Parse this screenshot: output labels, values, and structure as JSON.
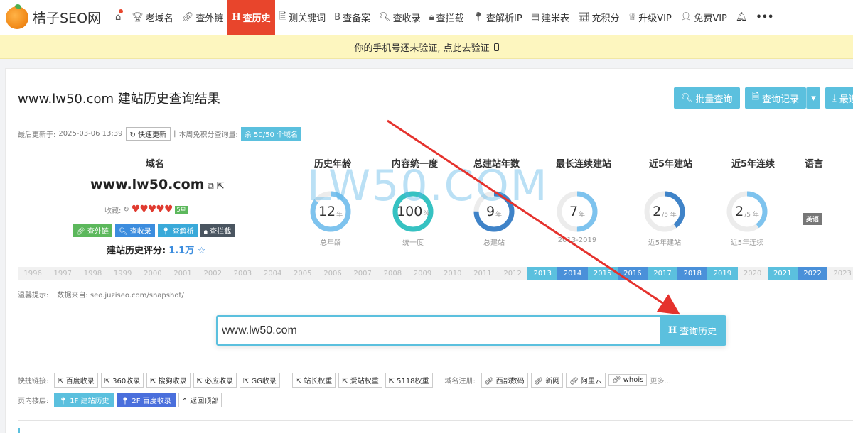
{
  "nav": {
    "logo_text": "桔子SEO网",
    "items": [
      {
        "label": "老域名",
        "icon": "trophy-icon",
        "glyph": "🏆︎"
      },
      {
        "label": "查外链",
        "icon": "link-icon",
        "glyph": "🔗︎"
      },
      {
        "label": "查历史",
        "icon": "h-icon",
        "glyph": "H"
      },
      {
        "label": "测关键词",
        "icon": "document-icon",
        "glyph": "🗎"
      },
      {
        "label": "查备案",
        "icon": "bold-b-icon",
        "glyph": "B"
      },
      {
        "label": "查收录",
        "icon": "search-icon",
        "glyph": "🔍︎"
      },
      {
        "label": "查拦截",
        "icon": "lock-icon",
        "glyph": "🔒︎"
      },
      {
        "label": "查解析IP",
        "icon": "map-pin-icon",
        "glyph": "📍︎"
      },
      {
        "label": "建米表",
        "icon": "table-icon",
        "glyph": "▤"
      },
      {
        "label": "充积分",
        "icon": "bar-chart-icon",
        "glyph": "📊︎"
      },
      {
        "label": "升级VIP",
        "icon": "crown-icon",
        "glyph": "♕"
      },
      {
        "label": "免费VIP",
        "icon": "user-plus-icon",
        "glyph": "👤︎"
      }
    ],
    "bell_glyph": "🔔︎",
    "more_glyph": "•••",
    "home_glyph": "⌂",
    "active_color": "#e8452c"
  },
  "notice": {
    "text": "你的手机号还未验证, 点此去验证"
  },
  "header": {
    "title": "www.lw50.com 建站历史查询结果",
    "btn_batch": "批量查询",
    "btn_records": "查询记录",
    "btn_recent": "最近"
  },
  "update": {
    "label": "最后更新于:",
    "time": "2025-03-06 13:39",
    "refresh": "快速更新",
    "quota_label": "本周免积分查询量:",
    "quota": "余 50/50 个域名"
  },
  "table": {
    "headers": [
      "域名",
      "历史年龄",
      "内容统一度",
      "总建站年数",
      "最长连续建站",
      "近5年建站",
      "近5年连续",
      "语言"
    ],
    "domain": "www.lw50.com",
    "fav_label": "收藏:",
    "hearts": "♥♥♥♥♥",
    "fav_tag": "5星",
    "tools": [
      "查外链",
      "查收录",
      "查解析",
      "查拦截"
    ],
    "score_label": "建站历史评分:",
    "score_value": "1.1万",
    "stats": [
      {
        "value": "12",
        "unit": "年",
        "label": "总年龄",
        "fraction": 0.85
      },
      {
        "value": "100",
        "unit": "%",
        "label": "统一度",
        "fraction": 1.0
      },
      {
        "value": "9",
        "unit": "年",
        "label": "总建站",
        "fraction": 0.75
      },
      {
        "value": "7",
        "unit": "年",
        "label": "2013-2019",
        "fraction": 0.5
      },
      {
        "value": "2",
        "unit": "/5 年",
        "label": "近5年建站",
        "fraction": 0.4
      },
      {
        "value": "2",
        "unit": "/5 年",
        "label": "近5年连续",
        "fraction": 0.4
      }
    ],
    "language": "英语"
  },
  "watermark": "LW50.COM",
  "years": [
    {
      "y": "1996",
      "on": false
    },
    {
      "y": "1997",
      "on": false
    },
    {
      "y": "1998",
      "on": false
    },
    {
      "y": "1999",
      "on": false
    },
    {
      "y": "2000",
      "on": false
    },
    {
      "y": "2001",
      "on": false
    },
    {
      "y": "2002",
      "on": false
    },
    {
      "y": "2003",
      "on": false
    },
    {
      "y": "2004",
      "on": false
    },
    {
      "y": "2005",
      "on": false
    },
    {
      "y": "2006",
      "on": false
    },
    {
      "y": "2007",
      "on": false
    },
    {
      "y": "2008",
      "on": false
    },
    {
      "y": "2009",
      "on": false
    },
    {
      "y": "2010",
      "on": false
    },
    {
      "y": "2011",
      "on": false
    },
    {
      "y": "2012",
      "on": false
    },
    {
      "y": "2013",
      "on": true,
      "lt": true
    },
    {
      "y": "2014",
      "on": true
    },
    {
      "y": "2015",
      "on": true,
      "lt": true
    },
    {
      "y": "2016",
      "on": true
    },
    {
      "y": "2017",
      "on": true,
      "lt": true
    },
    {
      "y": "2018",
      "on": true
    },
    {
      "y": "2019",
      "on": true,
      "lt": true
    },
    {
      "y": "2020",
      "on": false
    },
    {
      "y": "2021",
      "on": true,
      "lt": true
    },
    {
      "y": "2022",
      "on": true
    },
    {
      "y": "2023",
      "on": false
    }
  ],
  "tip": {
    "label": "温馨提示:",
    "source": "数据来自: seo.juziseo.com/snapshot/"
  },
  "search": {
    "value": "www.lw50.com",
    "button": "查询历史"
  },
  "quick_links": {
    "label": "快捷链接:",
    "group1": [
      "百度收录",
      "360收录",
      "搜狗收录",
      "必应收录",
      "GG收录"
    ],
    "group2": [
      "站长权重",
      "爱站权重",
      "5118权重"
    ],
    "reg_label": "域名注册:",
    "group3": [
      "西部数码",
      "新网",
      "阿里云",
      "whois"
    ],
    "more": "更多..."
  },
  "floors": {
    "label": "页内楼层:",
    "f1": "1F 建站历史",
    "f2": "2F 百度收录",
    "top": "返回顶部"
  },
  "colors": {
    "accent": "#5bc0de",
    "blue": "#4a90d9",
    "notice_bg": "#fdf6bf"
  }
}
